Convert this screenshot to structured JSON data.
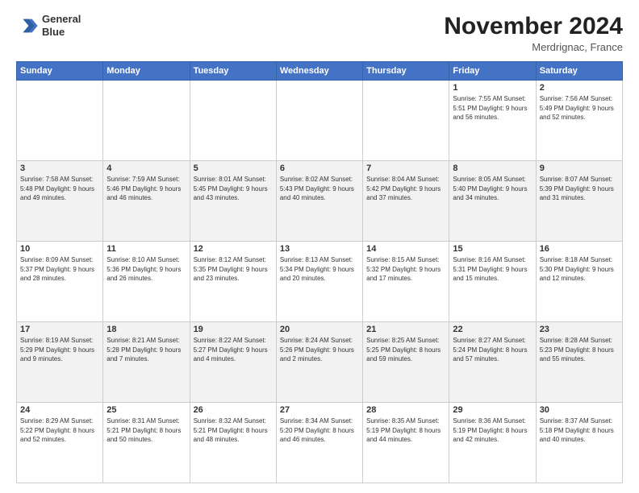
{
  "header": {
    "logo_line1": "General",
    "logo_line2": "Blue",
    "month_title": "November 2024",
    "location": "Merdrignac, France"
  },
  "weekdays": [
    "Sunday",
    "Monday",
    "Tuesday",
    "Wednesday",
    "Thursday",
    "Friday",
    "Saturday"
  ],
  "weeks": [
    [
      {
        "day": "",
        "info": ""
      },
      {
        "day": "",
        "info": ""
      },
      {
        "day": "",
        "info": ""
      },
      {
        "day": "",
        "info": ""
      },
      {
        "day": "",
        "info": ""
      },
      {
        "day": "1",
        "info": "Sunrise: 7:55 AM\nSunset: 5:51 PM\nDaylight: 9 hours and 56 minutes."
      },
      {
        "day": "2",
        "info": "Sunrise: 7:56 AM\nSunset: 5:49 PM\nDaylight: 9 hours and 52 minutes."
      }
    ],
    [
      {
        "day": "3",
        "info": "Sunrise: 7:58 AM\nSunset: 5:48 PM\nDaylight: 9 hours and 49 minutes."
      },
      {
        "day": "4",
        "info": "Sunrise: 7:59 AM\nSunset: 5:46 PM\nDaylight: 9 hours and 46 minutes."
      },
      {
        "day": "5",
        "info": "Sunrise: 8:01 AM\nSunset: 5:45 PM\nDaylight: 9 hours and 43 minutes."
      },
      {
        "day": "6",
        "info": "Sunrise: 8:02 AM\nSunset: 5:43 PM\nDaylight: 9 hours and 40 minutes."
      },
      {
        "day": "7",
        "info": "Sunrise: 8:04 AM\nSunset: 5:42 PM\nDaylight: 9 hours and 37 minutes."
      },
      {
        "day": "8",
        "info": "Sunrise: 8:05 AM\nSunset: 5:40 PM\nDaylight: 9 hours and 34 minutes."
      },
      {
        "day": "9",
        "info": "Sunrise: 8:07 AM\nSunset: 5:39 PM\nDaylight: 9 hours and 31 minutes."
      }
    ],
    [
      {
        "day": "10",
        "info": "Sunrise: 8:09 AM\nSunset: 5:37 PM\nDaylight: 9 hours and 28 minutes."
      },
      {
        "day": "11",
        "info": "Sunrise: 8:10 AM\nSunset: 5:36 PM\nDaylight: 9 hours and 26 minutes."
      },
      {
        "day": "12",
        "info": "Sunrise: 8:12 AM\nSunset: 5:35 PM\nDaylight: 9 hours and 23 minutes."
      },
      {
        "day": "13",
        "info": "Sunrise: 8:13 AM\nSunset: 5:34 PM\nDaylight: 9 hours and 20 minutes."
      },
      {
        "day": "14",
        "info": "Sunrise: 8:15 AM\nSunset: 5:32 PM\nDaylight: 9 hours and 17 minutes."
      },
      {
        "day": "15",
        "info": "Sunrise: 8:16 AM\nSunset: 5:31 PM\nDaylight: 9 hours and 15 minutes."
      },
      {
        "day": "16",
        "info": "Sunrise: 8:18 AM\nSunset: 5:30 PM\nDaylight: 9 hours and 12 minutes."
      }
    ],
    [
      {
        "day": "17",
        "info": "Sunrise: 8:19 AM\nSunset: 5:29 PM\nDaylight: 9 hours and 9 minutes."
      },
      {
        "day": "18",
        "info": "Sunrise: 8:21 AM\nSunset: 5:28 PM\nDaylight: 9 hours and 7 minutes."
      },
      {
        "day": "19",
        "info": "Sunrise: 8:22 AM\nSunset: 5:27 PM\nDaylight: 9 hours and 4 minutes."
      },
      {
        "day": "20",
        "info": "Sunrise: 8:24 AM\nSunset: 5:26 PM\nDaylight: 9 hours and 2 minutes."
      },
      {
        "day": "21",
        "info": "Sunrise: 8:25 AM\nSunset: 5:25 PM\nDaylight: 8 hours and 59 minutes."
      },
      {
        "day": "22",
        "info": "Sunrise: 8:27 AM\nSunset: 5:24 PM\nDaylight: 8 hours and 57 minutes."
      },
      {
        "day": "23",
        "info": "Sunrise: 8:28 AM\nSunset: 5:23 PM\nDaylight: 8 hours and 55 minutes."
      }
    ],
    [
      {
        "day": "24",
        "info": "Sunrise: 8:29 AM\nSunset: 5:22 PM\nDaylight: 8 hours and 52 minutes."
      },
      {
        "day": "25",
        "info": "Sunrise: 8:31 AM\nSunset: 5:21 PM\nDaylight: 8 hours and 50 minutes."
      },
      {
        "day": "26",
        "info": "Sunrise: 8:32 AM\nSunset: 5:21 PM\nDaylight: 8 hours and 48 minutes."
      },
      {
        "day": "27",
        "info": "Sunrise: 8:34 AM\nSunset: 5:20 PM\nDaylight: 8 hours and 46 minutes."
      },
      {
        "day": "28",
        "info": "Sunrise: 8:35 AM\nSunset: 5:19 PM\nDaylight: 8 hours and 44 minutes."
      },
      {
        "day": "29",
        "info": "Sunrise: 8:36 AM\nSunset: 5:19 PM\nDaylight: 8 hours and 42 minutes."
      },
      {
        "day": "30",
        "info": "Sunrise: 8:37 AM\nSunset: 5:18 PM\nDaylight: 8 hours and 40 minutes."
      }
    ]
  ]
}
